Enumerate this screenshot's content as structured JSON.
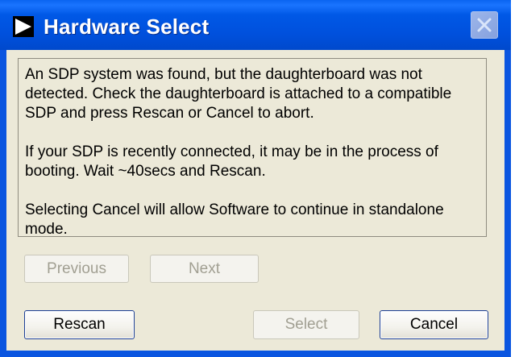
{
  "window": {
    "title": "Hardware Select"
  },
  "message": {
    "paragraphs": [
      "An SDP system was found, but the daughterboard was not detected. Check the daughterboard is attached to a compatible SDP and press Rescan or Cancel to abort.",
      "If your SDP is recently connected, it may be in the process of booting. Wait ~40secs and Rescan.",
      "Selecting Cancel will allow Software to continue in standalone mode."
    ]
  },
  "buttons": {
    "previous": "Previous",
    "next": "Next",
    "rescan": "Rescan",
    "select": "Select",
    "cancel": "Cancel"
  },
  "colors": {
    "titlebar": "#0055e5",
    "dialog_face": "#ece9d8"
  }
}
